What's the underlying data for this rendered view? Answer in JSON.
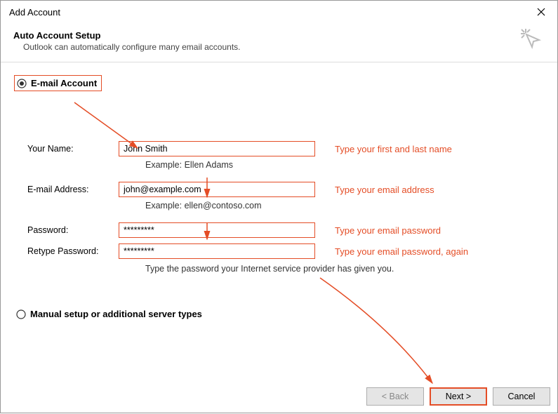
{
  "window": {
    "title": "Add Account"
  },
  "header": {
    "title": "Auto Account Setup",
    "subtitle": "Outlook can automatically configure many email accounts."
  },
  "radios": {
    "email_account": "E-mail Account",
    "manual_setup": "Manual setup or additional server types"
  },
  "fields": {
    "name": {
      "label": "Your Name:",
      "value": "John Smith",
      "example": "Example: Ellen Adams",
      "hint": "Type your first and last name"
    },
    "email": {
      "label": "E-mail Address:",
      "value": "john@example.com",
      "example": "Example: ellen@contoso.com",
      "hint": "Type your email address"
    },
    "password": {
      "label": "Password:",
      "value": "*********",
      "hint": "Type your email password"
    },
    "retype": {
      "label": "Retype Password:",
      "value": "*********",
      "hint": "Type your email password, again"
    },
    "password_help": "Type the password your Internet service provider has given you."
  },
  "footer": {
    "back": "< Back",
    "next": "Next >",
    "cancel": "Cancel"
  },
  "colors": {
    "annotation": "#e44d26"
  }
}
